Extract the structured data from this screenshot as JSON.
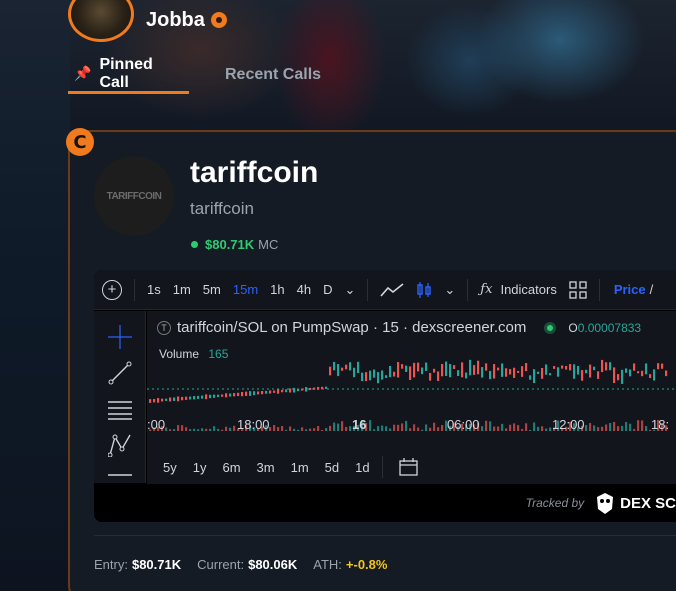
{
  "profile": {
    "username": "Jobba"
  },
  "tabs": [
    {
      "label": "Pinned Call",
      "active": true
    },
    {
      "label": "Recent Calls",
      "active": false
    }
  ],
  "token": {
    "logo_text": "TARIFFCOIN",
    "name": "tariffcoin",
    "ticker": "tariffcoin",
    "market_cap": "$80.71K",
    "market_cap_label": "MC"
  },
  "chart_toolbar": {
    "timeframes": [
      "1s",
      "1m",
      "5m",
      "15m",
      "1h",
      "4h",
      "D"
    ],
    "active_timeframe": "15m",
    "indicators_label": "Indicators",
    "price_label": "Price",
    "price_sep": "/"
  },
  "chart": {
    "pair_title": "tariffcoin/SOL on PumpSwap · 15 · dexscreener.com",
    "pair_badge": "T",
    "ohlc_o_label": "O",
    "ohlc_o_value": "0.00007833",
    "volume_label": "Volume",
    "volume_value": "165",
    "time_labels": [
      ":00",
      "18:00",
      "16",
      "06:00",
      "12:00",
      "18:"
    ],
    "ranges": [
      "5y",
      "1y",
      "6m",
      "3m",
      "1m",
      "5d",
      "1d"
    ]
  },
  "tracked": {
    "label": "Tracked by",
    "brand": "DEX SC"
  },
  "stats": {
    "entry_label": "Entry:",
    "entry_value": "$80.71K",
    "current_label": "Current:",
    "current_value": "$80.06K",
    "ath_label": "ATH:",
    "ath_value": "+-0.8%"
  },
  "colors": {
    "accent": "#f07a1e",
    "positive": "#2ecc71",
    "candle_up": "#26a69a",
    "candle_down": "#ef5350",
    "active_blue": "#2962ff",
    "ath": "#f5c518"
  },
  "icons": [
    "pin-icon",
    "verified-icon",
    "call-badge-icon",
    "plus-icon",
    "line-chart-icon",
    "candles-icon",
    "fx-icon",
    "layout-icon",
    "crosshair-icon",
    "trendline-icon",
    "fib-icon",
    "pattern-icon",
    "date-range-icon",
    "dex-owl-icon"
  ]
}
